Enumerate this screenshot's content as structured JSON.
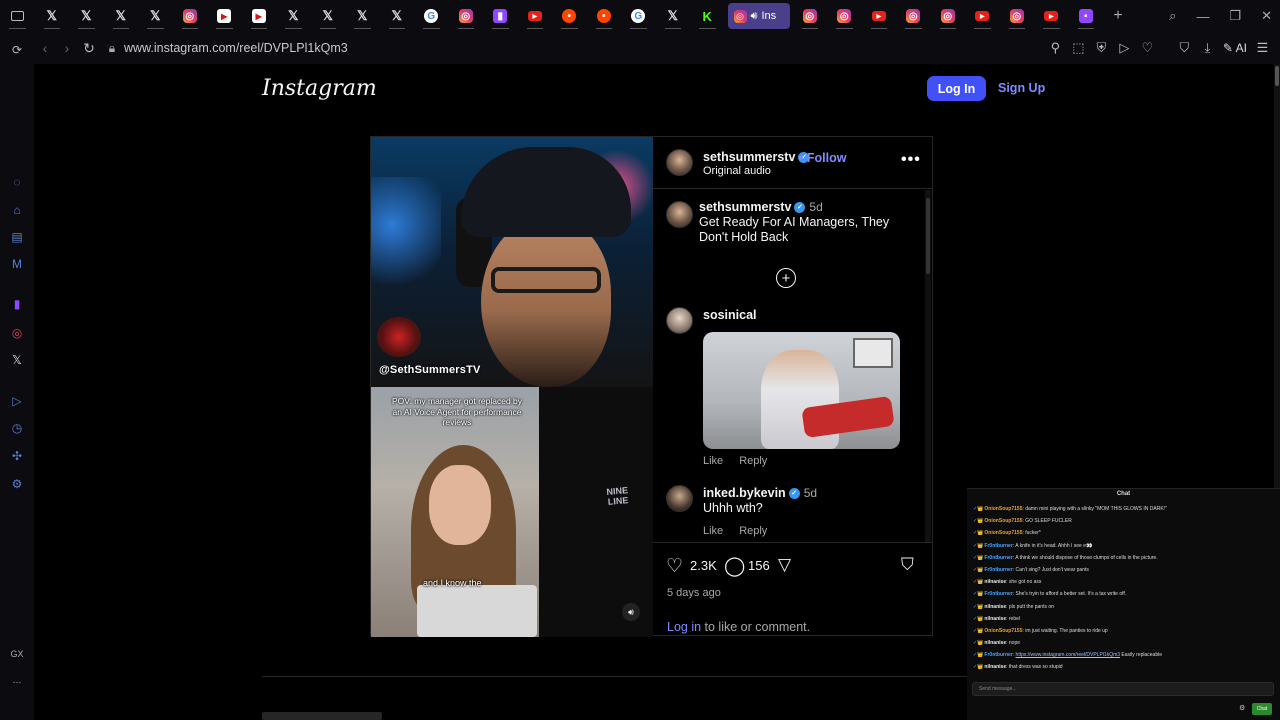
{
  "browser": {
    "tabs": [
      {
        "icon": "mail-icon",
        "cls": "ic-mail",
        "glyph": ""
      },
      {
        "icon": "x-icon",
        "cls": "ic-x",
        "glyph": "𝕏"
      },
      {
        "icon": "x-icon",
        "cls": "ic-x",
        "glyph": "𝕏"
      },
      {
        "icon": "x-icon",
        "cls": "ic-x",
        "glyph": "𝕏"
      },
      {
        "icon": "x-icon",
        "cls": "ic-x",
        "glyph": "𝕏"
      },
      {
        "icon": "instagram-icon",
        "cls": "ic-ig",
        "glyph": "◎"
      },
      {
        "icon": "play-icon",
        "cls": "ic-play",
        "glyph": "▶"
      },
      {
        "icon": "play-icon",
        "cls": "ic-play",
        "glyph": "▶"
      },
      {
        "icon": "x-icon",
        "cls": "ic-x",
        "glyph": "𝕏"
      },
      {
        "icon": "x-icon",
        "cls": "ic-x",
        "glyph": "𝕏"
      },
      {
        "icon": "x-icon",
        "cls": "ic-x",
        "glyph": "𝕏"
      },
      {
        "icon": "x-icon",
        "cls": "ic-x",
        "glyph": "𝕏"
      },
      {
        "icon": "google-icon",
        "cls": "ic-g",
        "glyph": "G"
      },
      {
        "icon": "instagram-icon",
        "cls": "ic-ig",
        "glyph": "◎"
      },
      {
        "icon": "twitch-icon",
        "cls": "ic-tw",
        "glyph": "▮"
      },
      {
        "icon": "youtube-icon",
        "cls": "ic-yt",
        "glyph": "▶"
      },
      {
        "icon": "reddit-icon",
        "cls": "ic-rd",
        "glyph": "•"
      },
      {
        "icon": "reddit-icon",
        "cls": "ic-rd",
        "glyph": "•"
      },
      {
        "icon": "google-icon",
        "cls": "ic-g",
        "glyph": "G"
      },
      {
        "icon": "x-icon",
        "cls": "ic-x",
        "glyph": "𝕏"
      },
      {
        "icon": "kick-icon",
        "cls": "ic-kick",
        "glyph": "K"
      }
    ],
    "active_tab": {
      "icon": "instagram-icon",
      "audio_icon": "speaker-icon",
      "label": "Ins"
    },
    "tabs_after": [
      {
        "icon": "instagram-icon",
        "cls": "ic-ig",
        "glyph": "◎"
      },
      {
        "icon": "instagram-icon",
        "cls": "ic-ig",
        "glyph": "◎"
      },
      {
        "icon": "youtube-icon",
        "cls": "ic-yt",
        "glyph": "▶"
      },
      {
        "icon": "instagram-icon",
        "cls": "ic-ig",
        "glyph": "◎"
      },
      {
        "icon": "instagram-icon",
        "cls": "ic-ig",
        "glyph": "◎"
      },
      {
        "icon": "youtube-icon",
        "cls": "ic-yt",
        "glyph": "▶"
      },
      {
        "icon": "instagram-icon",
        "cls": "ic-ig",
        "glyph": "◎"
      },
      {
        "icon": "youtube-icon",
        "cls": "ic-yt",
        "glyph": "▶"
      },
      {
        "icon": "app-icon",
        "cls": "ic-tw",
        "glyph": "▪"
      }
    ],
    "url": "www.instagram.com/reel/DVPLPl1kQm3",
    "ai_label": "AI"
  },
  "sidebar_icons": [
    {
      "name": "messenger-icon",
      "glyph": "◌",
      "cls": ""
    },
    {
      "name": "translate-icon",
      "glyph": "⌂",
      "cls": ""
    },
    {
      "name": "notes-icon",
      "glyph": "▤",
      "cls": ""
    },
    {
      "name": "m-icon",
      "glyph": "M",
      "cls": ""
    },
    {
      "name": "twitch-icon",
      "glyph": "▮",
      "cls": "tw"
    },
    {
      "name": "instagram-icon",
      "glyph": "◎",
      "cls": "ig"
    },
    {
      "name": "x-icon",
      "glyph": "𝕏",
      "cls": "xx"
    },
    {
      "name": "player-icon",
      "glyph": "▷",
      "cls": ""
    },
    {
      "name": "history-icon",
      "glyph": "◷",
      "cls": ""
    },
    {
      "name": "extensions-icon",
      "glyph": "✣",
      "cls": ""
    },
    {
      "name": "settings-icon",
      "glyph": "⚙",
      "cls": ""
    },
    {
      "name": "gx-icon",
      "glyph": "GX",
      "cls": "gx"
    },
    {
      "name": "more-icon",
      "glyph": "⋯",
      "cls": "gx"
    }
  ],
  "instagram": {
    "logo": "Instagram",
    "login_label": "Log In",
    "signup_label": "Sign Up"
  },
  "video": {
    "handle": "@SethSummersTV",
    "inset_text": "POV: my manager got replaced by an AI Voice Agent for performance reviews",
    "caption": "and I know the",
    "watermark": "NINE\nLINE"
  },
  "post": {
    "author": "sethsummerstv",
    "follow_label": "Follow",
    "audio": "Original audio",
    "caption_author": "sethsummerstv",
    "caption_time": "5d",
    "caption_text": "Get Ready For AI Managers, They Don't Hold Back",
    "comments": [
      {
        "user": "sosinical",
        "time": "",
        "text": "",
        "has_gif": true
      },
      {
        "user": "inked.bykevin",
        "time": "5d",
        "text": "Uhhh wth?",
        "has_gif": false
      }
    ],
    "like_label": "Like",
    "reply_label": "Reply",
    "likes": "2.3K",
    "comments_count": "156",
    "posted": "5 days ago",
    "login_link": "Log in",
    "login_suffix": " to like or comment."
  },
  "chat": {
    "title": "Chat",
    "messages": [
      {
        "user": "OnionSoup7155",
        "color": "#f0a030",
        "text": "damn mini playing with a slinky \"MOM THIS GLOWS IN DARK!\"",
        "link": ""
      },
      {
        "user": "OnionSoup7155",
        "color": "#f0a030",
        "text": "GO SLEEP FUCLER",
        "link": ""
      },
      {
        "user": "OnionSoup7155",
        "color": "#f0a030",
        "text": "fucker*",
        "link": ""
      },
      {
        "user": "Fr0ntburner",
        "color": "#4aa3ff",
        "text": "A knife in it's head. Ahhh I see e👀",
        "link": ""
      },
      {
        "user": "Fr0ntburner",
        "color": "#4aa3ff",
        "text": "A think we should dispose of those clumps of cells in the picture.",
        "link": ""
      },
      {
        "user": "Fr0ntburner",
        "color": "#4aa3ff",
        "text": "Can't sing? Just don't wear pants",
        "link": ""
      },
      {
        "user": "nilnanise",
        "color": "#e8e8e8",
        "text": "she got no ass",
        "link": ""
      },
      {
        "user": "Fr0ntburner",
        "color": "#4aa3ff",
        "text": "She's tryin to afford a better set. It's a tax write off.",
        "link": ""
      },
      {
        "user": "nilnanise",
        "color": "#e8e8e8",
        "text": "pls putt the pants on",
        "link": ""
      },
      {
        "user": "nilnanise",
        "color": "#e8e8e8",
        "text": "rebel",
        "link": ""
      },
      {
        "user": "OnionSoup7155",
        "color": "#f0a030",
        "text": "im just waiting. The panties to ride up",
        "link": ""
      },
      {
        "user": "nilnanise",
        "color": "#e8e8e8",
        "text": "nope",
        "link": ""
      },
      {
        "user": "Fr0ntburner",
        "color": "#4aa3ff",
        "text": " Easily replaceable",
        "link": "https://www.instagram.com/reel/DVPLPl1kQm3"
      },
      {
        "user": "nilnanise",
        "color": "#e8e8e8",
        "text": "that dress was so stupid",
        "link": ""
      }
    ],
    "input_placeholder": "Send message...",
    "send_label": "Chat"
  }
}
